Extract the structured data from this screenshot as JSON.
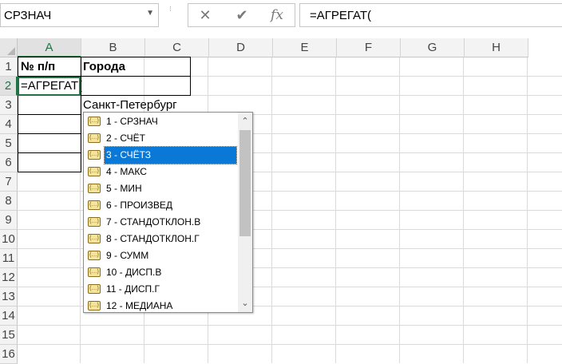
{
  "formula_bar": {
    "name_box": "СРЗНАЧ",
    "cancel_icon": "✕",
    "enter_icon": "✔",
    "fx_label": "fx",
    "formula": "=АГРЕГАТ("
  },
  "sheet": {
    "columns": [
      "A",
      "B",
      "C",
      "D",
      "E",
      "F",
      "G",
      "H"
    ],
    "rows": [
      "1",
      "2",
      "3",
      "4",
      "5",
      "6",
      "7",
      "8",
      "9",
      "10",
      "11",
      "12",
      "13",
      "14",
      "15",
      "16"
    ],
    "active_column": "A",
    "active_row": "2",
    "cells": {
      "A1": "№ п/п",
      "B1": "Города",
      "A2": "=АГРЕГАТ(",
      "B3": "Санкт-Петербург"
    }
  },
  "autocomplete": {
    "items": [
      "1 - СРЗНАЧ",
      "2 - СЧЁТ",
      "3 - СЧЁТЗ",
      "4 - МАКС",
      "5 - МИН",
      "6 - ПРОИЗВЕД",
      "7 - СТАНДОТКЛОН.В",
      "8 - СТАНДОТКЛОН.Г",
      "9 - СУММ",
      "10 - ДИСП.В",
      "11 - ДИСП.Г",
      "12 - МЕДИАНА"
    ],
    "selected_index": 2,
    "item_icon": "list-value-icon",
    "selection_color": "#0a78d7"
  },
  "colors": {
    "accent": "#217346"
  }
}
